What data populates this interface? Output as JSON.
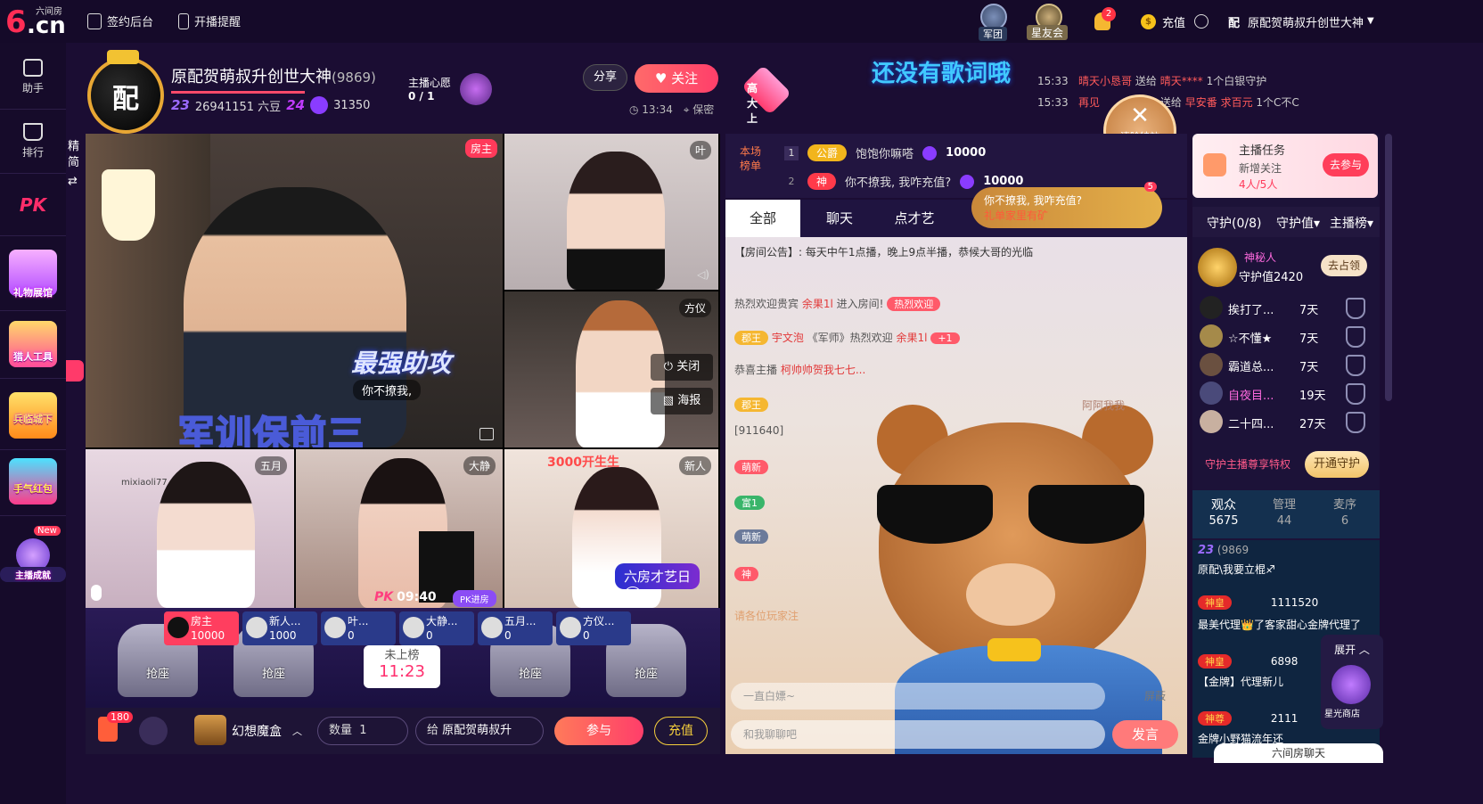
{
  "topbar": {
    "logo_sub": "六间房",
    "logo_six": "6",
    "logo_cn": ".cn",
    "nav_sign": "签约后台",
    "nav_remind": "开播提醒",
    "badge_army": "军团",
    "badge_star": "星友会",
    "bell_count": "2",
    "recharge": "充值",
    "user_name": "原配贺萌叔升创世大神"
  },
  "sidebar": {
    "items": [
      {
        "label": "助手"
      },
      {
        "label": "排行"
      },
      {
        "label": "PK"
      },
      {
        "label": "礼物展馆"
      },
      {
        "label": "猎人工具"
      },
      {
        "label": "兵临城下"
      },
      {
        "label": "手气红包"
      },
      {
        "label": "主播成就"
      }
    ],
    "new_badge": "New",
    "side_tab": "精简"
  },
  "room": {
    "avatar_char": "配",
    "host_name": "原配贺萌叔升创世大神",
    "host_id": "(9869)",
    "level1": "23",
    "beans": "26941151 六豆",
    "level2": "24",
    "points": "31350",
    "wish_label": "主播心愿",
    "wish_value": "0 / 1",
    "share": "分享",
    "follow": "关注",
    "time": "13:34",
    "location": "保密",
    "hot_btn": "高大上"
  },
  "song": "还没有歌词哦",
  "ticker": {
    "line1_time": "15:33",
    "line1_text_a": "晴天小恳哥",
    "line1_text_b": "送给",
    "line1_text_c": "晴天****",
    "line1_text_d": "1个白银守护",
    "line2_time": "15:33",
    "line2_text_a": "再见",
    "line2_text_b": "送给",
    "line2_text_c": "早安番",
    "line2_text_d": "求百元",
    "line2_text_e": "1个C不C"
  },
  "clear_fx": "清除特效",
  "video": {
    "host_tag": "房主",
    "main_caption": "军训保前三",
    "boost_title": "最强助攻",
    "boost_sub": "你不撩我,",
    "tags": [
      "叶",
      "方仪",
      "五月",
      "大静",
      "新人"
    ],
    "close_btn": "关闭",
    "poster_btn": "海报",
    "pk_time": "09:40",
    "pk_label": "PK",
    "pk_tag": "PK进房",
    "six_art": "六房才艺日",
    "red_note": "3000开生生",
    "watermark": "mixiaoli77"
  },
  "seats": {
    "cards": [
      {
        "name": "房主",
        "score": "10000"
      },
      {
        "name": "新人...",
        "score": "1000"
      },
      {
        "name": "叶...",
        "score": "0"
      },
      {
        "name": "大静...",
        "score": "0"
      },
      {
        "name": "五月...",
        "score": "0"
      },
      {
        "name": "方仪...",
        "score": "0"
      }
    ],
    "grab": "抢座",
    "rank_card_t1": "未上榜",
    "rank_card_t2": "11:23"
  },
  "bottombar": {
    "count": "180",
    "box_name": "幻想魔盒",
    "qty_label": "数量",
    "qty_value": "1",
    "to_label": "给",
    "to_name": "原配贺萌叔升",
    "join": "参与",
    "charge": "充值"
  },
  "rankbar": {
    "label": "本场榜单",
    "rows": [
      {
        "num": "1",
        "title": "公爵",
        "name": "饱饱你嘛嗒",
        "value": "10000"
      },
      {
        "num": "2",
        "title": "神",
        "name": "你不撩我, 我咋充值?",
        "value": "10000"
      }
    ],
    "popup_text": "你不撩我, 我咋充值?",
    "popup_sub": "礼单家里有矿",
    "popup_badge": "5"
  },
  "chat": {
    "tabs": [
      "全部",
      "聊天",
      "点才艺"
    ],
    "notice": "【房间公告】: 每天中午1点播，晚上9点半播，恭候大哥的光临",
    "m1_a": "热烈欢迎贵宾",
    "m1_b": "余果1l",
    "m1_c": "进入房间!",
    "m1_chip": "热烈欢迎",
    "m2_chip": "郡王",
    "m2_a": "宇文泡",
    "m2_b": "《军师》热烈欢迎",
    "m2_c": "余果1l",
    "m2_d": "+1",
    "m3_a": "恭喜主播",
    "m3_b": "柯帅帅贺我七七...",
    "m4_chip": "郡王",
    "m5_a": "[911640]",
    "chip_mengxin": "萌新",
    "chip_green": "富1",
    "chip_gray": "萌新",
    "chip_god": "神",
    "m9": "请各位玩家注",
    "m10": "阿阿我我",
    "quick_placeholder": "一直白嫖~",
    "screen": "屏蔽",
    "input_placeholder": "和我聊聊吧",
    "send": "发言"
  },
  "rcol": {
    "task_title": "主播任务",
    "task_desc": "新增关注",
    "task_progress": "4人/5人",
    "task_btn": "去参与",
    "gtabs": [
      "守护(0/8)",
      "守护值▾",
      "主播榜▾"
    ],
    "guard_top_name": "神秘人",
    "guard_top_value": "守护值2420",
    "guard_top_btn": "去占领",
    "guards": [
      {
        "name": "挨打了...",
        "days": "7天"
      },
      {
        "name": "☆不懂★",
        "days": "7天"
      },
      {
        "name": "霸道总...",
        "days": "7天"
      },
      {
        "name": "自夜目...",
        "days": "19天"
      },
      {
        "name": "二十四...",
        "days": "27天"
      }
    ],
    "privilege": "守护主播尊享特权",
    "open_guard": "开通守护",
    "aud_tabs": [
      {
        "label": "观众",
        "count": "5675"
      },
      {
        "label": "管理",
        "count": "44"
      },
      {
        "label": "麦序",
        "count": "6"
      }
    ],
    "aud1_id": "(9869",
    "aud1_text": "原配\\我要立棍♐",
    "aud2_god": "神皇",
    "aud2_num": "1111520",
    "aud2_text": "最美代理👑了客家甜心金牌代理了",
    "aud3_god": "神皇",
    "aud3_num": "6898",
    "aud3_text": "【金牌】代理新儿",
    "aud4_god": "神尊",
    "aud4_num": "2111",
    "aud4_text": "金牌小野猫流年还",
    "expand": "展开",
    "store": "星光商店",
    "chat6": "六间房聊天"
  }
}
